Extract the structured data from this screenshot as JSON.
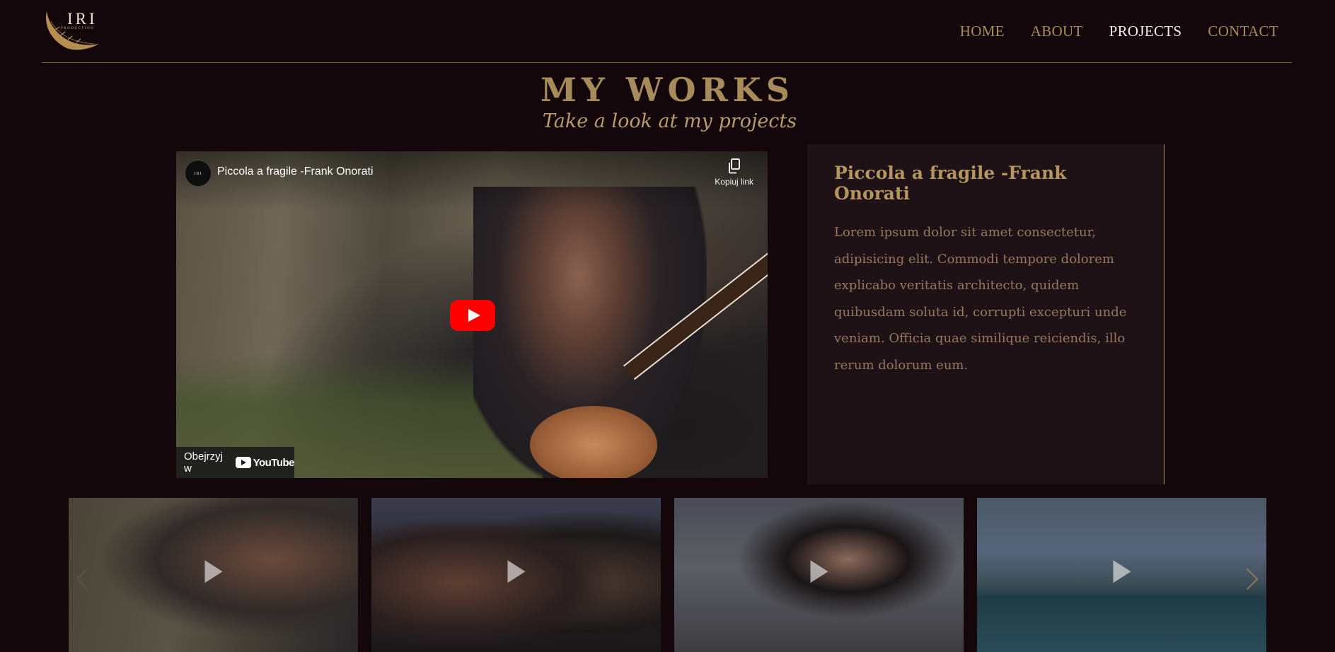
{
  "brand": {
    "name": "IRI",
    "sub": "PRODUCTION"
  },
  "nav": [
    {
      "label": "HOME",
      "active": false
    },
    {
      "label": "ABOUT",
      "active": false
    },
    {
      "label": "PROJECTS",
      "active": true
    },
    {
      "label": "CONTACT",
      "active": false
    }
  ],
  "section": {
    "title": "MY WORKS",
    "subtitle": "Take a look at my projects"
  },
  "video": {
    "channel_avatar": "IRI",
    "title": "Piccola a fragile -Frank Onorati",
    "copy_link_label": "Kopiuj link",
    "watch_on_label": "Obejrzyj w",
    "platform": "YouTube",
    "play_button_color": "#ff0000"
  },
  "project": {
    "title": "Piccola a fragile -Frank Onorati",
    "description": "Lorem ipsum dolor sit amet consectetur, adipisicing elit. Commodi tempore dolorem explicabo veritatis architecto, quidem quibusdam soluta id, corrupti excepturi unde veniam. Officia quae similique reiciendis, illo rerum dolorum eum."
  },
  "thumbnails": [
    {
      "subject": "guitarist-performance"
    },
    {
      "subject": "studio-recording"
    },
    {
      "subject": "singer-outdoor"
    },
    {
      "subject": "kitesurfing"
    }
  ],
  "colors": {
    "background": "#13070c",
    "accent_gold": "#a88b5a",
    "nav_active": "#f3ece0",
    "card_bg": "#1e1217"
  }
}
